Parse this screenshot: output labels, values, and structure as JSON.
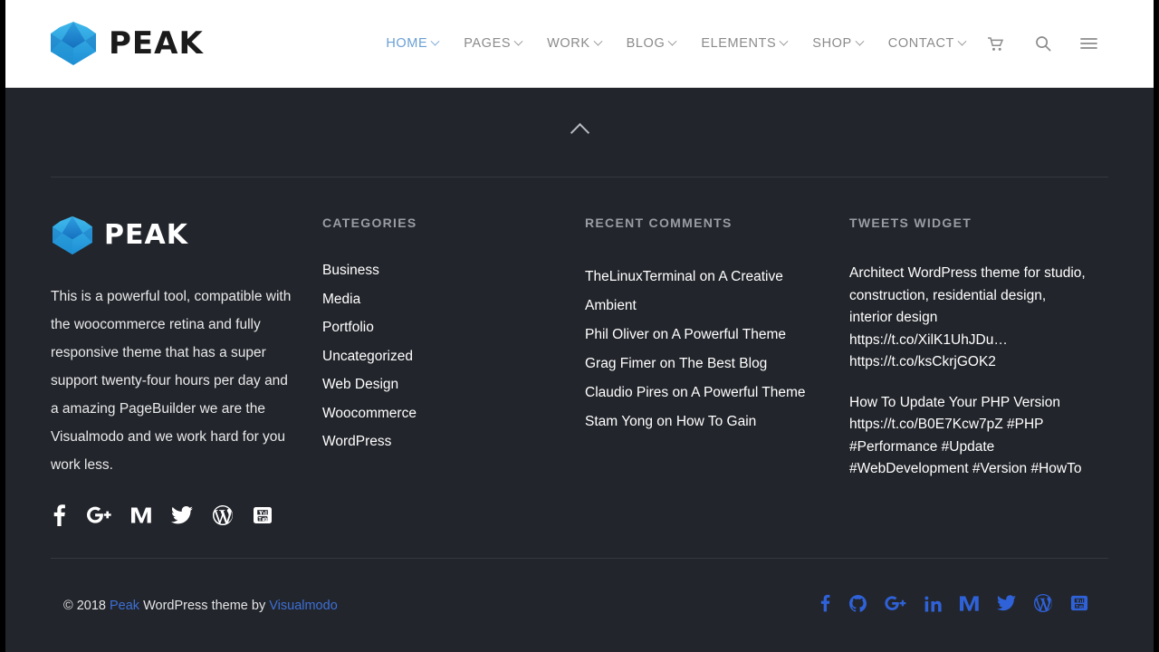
{
  "header": {
    "brand": {
      "wordmark": "PEAK",
      "logo_icon": "peak-crown-logo"
    },
    "nav": [
      {
        "label": "HOME",
        "has_dropdown": true,
        "active": true
      },
      {
        "label": "PAGES",
        "has_dropdown": true,
        "active": false
      },
      {
        "label": "WORK",
        "has_dropdown": true,
        "active": false
      },
      {
        "label": "BLOG",
        "has_dropdown": true,
        "active": false
      },
      {
        "label": "ELEMENTS",
        "has_dropdown": true,
        "active": false
      },
      {
        "label": "SHOP",
        "has_dropdown": true,
        "active": false
      },
      {
        "label": "CONTACT",
        "has_dropdown": true,
        "active": false
      }
    ],
    "icons": {
      "cart": "cart-icon",
      "search": "search-icon",
      "menu": "hamburger-menu-icon"
    },
    "accent_color": "#6a9fd4",
    "nav_color": "#8b8b8b"
  },
  "footer": {
    "scroll_top_icon": "chevron-up-icon",
    "about": {
      "wordmark": "PEAK",
      "logo_icon": "peak-crown-logo",
      "text": "This is a powerful tool, compatible with the woocommerce retina and fully responsive theme that has a super support twenty-four hours per day and a amazing PageBuilder we are the Visualmodo and we work hard for you work less.",
      "social": [
        {
          "name": "facebook-icon",
          "label": "Facebook"
        },
        {
          "name": "google-plus-icon",
          "label": "Google Plus"
        },
        {
          "name": "medium-icon",
          "label": "Medium"
        },
        {
          "name": "twitter-icon",
          "label": "Twitter"
        },
        {
          "name": "wordpress-icon",
          "label": "WordPress"
        },
        {
          "name": "youtube-icon",
          "label": "YouTube"
        }
      ]
    },
    "categories": {
      "title": "CATEGORIES",
      "items": [
        "Business",
        "Media",
        "Portfolio",
        "Uncategorized",
        "Web Design",
        "Woocommerce",
        "WordPress"
      ]
    },
    "recent_comments": {
      "title": "RECENT COMMENTS",
      "items": [
        "TheLinuxTerminal on A Creative Ambient",
        "Phil Oliver on A Powerful Theme",
        "Grag Fimer on The Best Blog",
        "Claudio Pires on A Powerful Theme",
        "Stam Yong on How To Gain"
      ]
    },
    "tweets": {
      "title": "TWEETS WIDGET",
      "items": [
        "Architect WordPress theme for studio, construction, residential design, interior design https://t.co/XilK1UhJDu… https://t.co/ksCkrjGOK2",
        "How To Update Your PHP Version https://t.co/B0E7Kcw7pZ #PHP #Performance #Update #WebDevelopment #Version #HowTo"
      ]
    },
    "bottom": {
      "copyright_prefix": "© 2018 ",
      "link1": "Peak",
      "copyright_middle": " WordPress theme by ",
      "link2": "Visualmodo",
      "link_color": "#3d6fd6",
      "social": [
        {
          "name": "facebook-icon",
          "label": "Facebook"
        },
        {
          "name": "github-icon",
          "label": "GitHub"
        },
        {
          "name": "google-plus-icon",
          "label": "Google Plus"
        },
        {
          "name": "linkedin-icon",
          "label": "LinkedIn"
        },
        {
          "name": "medium-icon",
          "label": "Medium"
        },
        {
          "name": "twitter-icon",
          "label": "Twitter"
        },
        {
          "name": "wordpress-icon",
          "label": "WordPress"
        },
        {
          "name": "youtube-icon",
          "label": "YouTube"
        }
      ]
    },
    "background_color": "#22252b",
    "heading_color": "#9a9da3"
  }
}
